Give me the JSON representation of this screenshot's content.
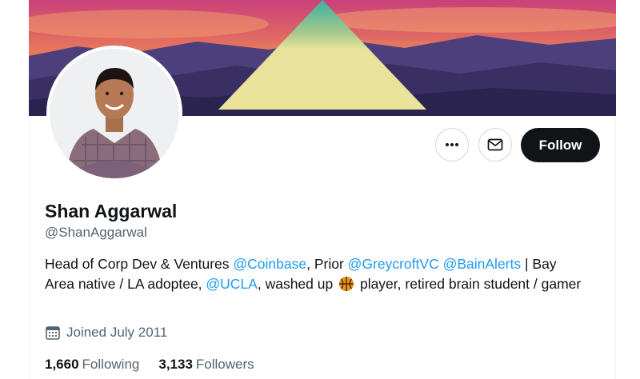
{
  "profile": {
    "name": "Shan Aggarwal",
    "handle": "@ShanAggarwal",
    "bio": {
      "p1": "Head of Corp Dev & Ventures ",
      "m1": "@Coinbase",
      "p2": ", Prior ",
      "m2": "@GreycroftVC",
      "p3": " ",
      "m3": "@BainAlerts",
      "p4": " | Bay Area native / LA adoptee, ",
      "m4": "@UCLA",
      "p5": ", washed up ",
      "emoji_icon": "basketball-icon",
      "p6": " player, retired brain student / gamer"
    },
    "joined": "Joined July 2011",
    "following_count": "1,660",
    "following_label": "Following",
    "followers_count": "3,133",
    "followers_label": "Followers"
  },
  "actions": {
    "more_icon": "more-icon",
    "message_icon": "mail-icon",
    "follow_label": "Follow"
  },
  "colors": {
    "accent": "#1d9bf0",
    "text_primary": "#0f1419",
    "text_secondary": "#536471",
    "follow_bg": "#0f1419"
  }
}
